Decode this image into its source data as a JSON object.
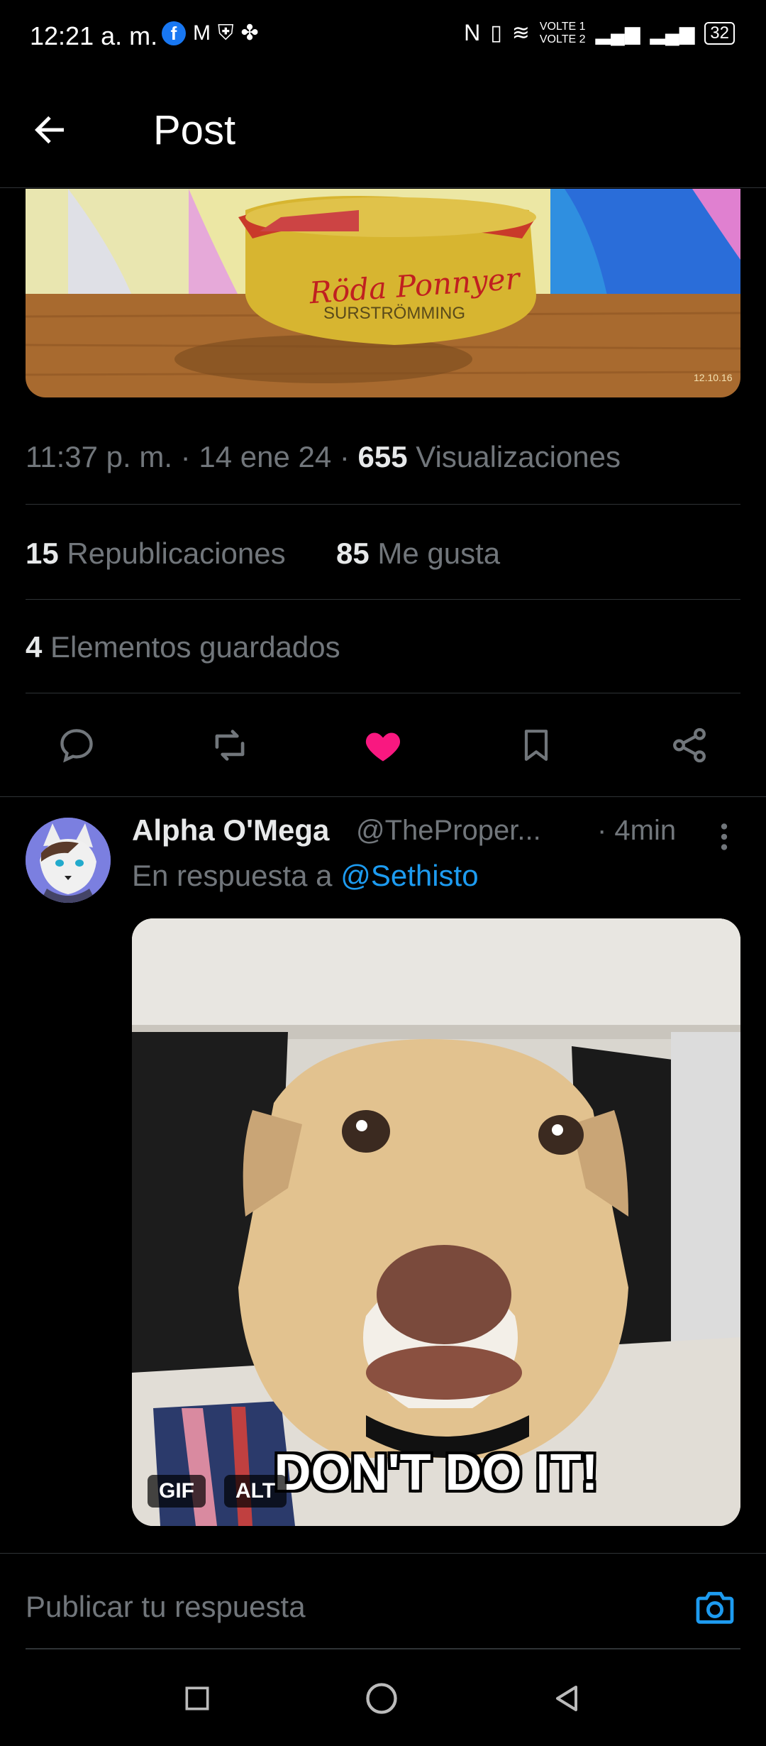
{
  "status_bar": {
    "time": "12:21 a. m.",
    "left_icons": [
      "facebook-icon",
      "gmail-icon",
      "vpn-shield-icon",
      "pinwheel-icon"
    ],
    "right_icons": [
      "nfc-icon",
      "vibrate-icon",
      "wifi-icon",
      "signal-icon",
      "signal-icon"
    ],
    "volte1": "VOLTE 1",
    "volte2": "VOLTE 2",
    "battery": "32"
  },
  "header": {
    "title": "Post"
  },
  "post_meta": {
    "time": "11:37 p. m.",
    "date": "14 ene 24",
    "views_count": "655",
    "views_label": "Visualizaciones",
    "reposts_count": "15",
    "reposts_label": "Republicaciones",
    "likes_count": "85",
    "likes_label": "Me gusta",
    "saved_count": "4",
    "saved_label": "Elementos guardados"
  },
  "image1": {
    "brand_text": "Röda Ponnyer",
    "product_text": "SURSTRÖMMING",
    "date_text": "12.10.16"
  },
  "actions": [
    "reply-icon",
    "repost-icon",
    "like-icon",
    "bookmark-icon",
    "share-icon"
  ],
  "colors": {
    "like": "#f91880",
    "link": "#1d9bf0",
    "muted": "#71767b",
    "text": "#e7e9ea",
    "border": "#2f3336"
  },
  "reply": {
    "name": "Alpha O'Mega",
    "handle": "@TheProper...",
    "time": "· 4min",
    "reply_to_prefix": "En respuesta a",
    "reply_to_handle": "@Sethisto",
    "gif_badge": "GIF",
    "alt_badge": "ALT",
    "gif_caption": "DON'T DO IT!"
  },
  "composer": {
    "placeholder": "Publicar tu respuesta"
  }
}
